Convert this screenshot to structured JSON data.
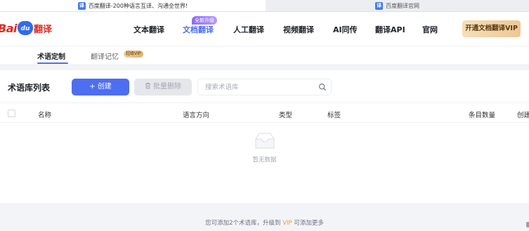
{
  "browser_tabs": [
    {
      "icon": "baidu-translate-favicon",
      "label": "百度翻译-200种语言互译、沟通全世界!"
    },
    {
      "icon": "baidu-translate-favicon",
      "label": "百度翻译官网"
    }
  ],
  "header": {
    "logo": {
      "bai": "Bai",
      "du": "du",
      "fanyi": "翻译"
    },
    "nav": [
      {
        "label": "文本翻译"
      },
      {
        "label": "文档翻译"
      },
      {
        "label": "人工翻译"
      },
      {
        "label": "视频翻译"
      },
      {
        "label": "AI同传"
      },
      {
        "label": "翻译API"
      },
      {
        "label": "官网"
      }
    ],
    "active_nav": "文档翻译",
    "new_badge": "全新升级",
    "vip_button": "开通文档翻译VIP"
  },
  "subtabs": {
    "items": [
      {
        "label": "术语定制",
        "active": true
      },
      {
        "label": "翻译记忆",
        "badge": "超级VIP"
      }
    ]
  },
  "library": {
    "title": "术语库列表",
    "create_button": "+ 创建",
    "batch_delete_button": "批量删除",
    "search_placeholder": "搜索术语库",
    "columns": [
      "名称",
      "语言方向",
      "类型",
      "标签",
      "条目数量",
      "创建"
    ],
    "rows": [],
    "empty_text": "暂无数据"
  },
  "footer": {
    "text_before": "您可添加2个术语库，升级到 ",
    "vip_link": "VIP",
    "text_after": " 可添加更多"
  },
  "colors": {
    "accent": "#4e6ef2",
    "brand_red": "#e02a20",
    "vip_gold": "#e6a23c"
  }
}
